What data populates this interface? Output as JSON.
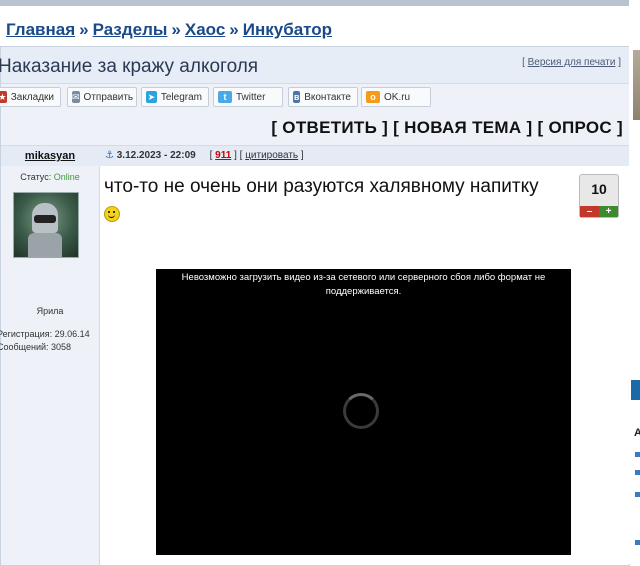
{
  "breadcrumb": {
    "items": [
      "Главная",
      "Разделы",
      "Хаос",
      "Инкубатор"
    ],
    "separator": "»"
  },
  "topic": {
    "title": "Наказание за кражу алкоголя",
    "print_version": "Версия для печати"
  },
  "share_buttons": [
    {
      "label": "Закладки",
      "icon": "bookmark-icon",
      "color": "#c0392b"
    },
    {
      "label": "Отправить",
      "icon": "mail-icon",
      "color": "#7a8aa0"
    },
    {
      "label": "Telegram",
      "icon": "telegram-icon",
      "color": "#2aa3df"
    },
    {
      "label": "Twitter",
      "icon": "twitter-icon",
      "color": "#4aa8e8"
    },
    {
      "label": "Вконтакте",
      "icon": "vk-icon",
      "color": "#4a76a8"
    },
    {
      "label": "OK.ru",
      "icon": "ok-icon",
      "color": "#f59a1a"
    }
  ],
  "actions": {
    "reply": "ОТВЕТИТЬ",
    "new_topic": "НОВАЯ ТЕМА",
    "poll": "ОПРОС"
  },
  "post": {
    "author": "mikasyan",
    "status_label": "Статус:",
    "status_value": "Online",
    "nick": "Ярила",
    "registration": "Регистрация: 29.06.14",
    "messages": "Сообщений: 3058",
    "date": "3.12.2023 - 22:09",
    "number": "911",
    "quote": "цитировать",
    "text": "что-то не очень они разуются халявному напитку",
    "rating": "10",
    "rating_minus": "–",
    "rating_plus": "+",
    "video_error": "Невозможно загрузить видео из-за сетевого или серверного сбоя либо формат не поддерживается."
  }
}
